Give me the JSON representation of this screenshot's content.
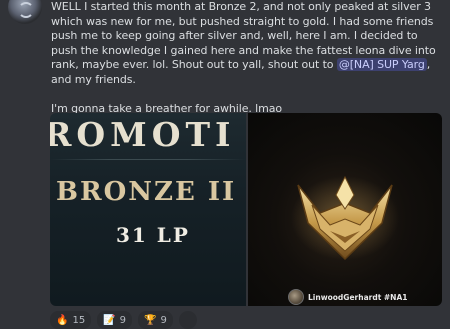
{
  "message": {
    "line1_part1": "WELL I started this month at Bronze 2, and not only peaked at silver 3 which was new for me, but pushed straight to gold. I had some friends push me to keep going after silver and, well, here I am. I decided to push the knowledge I gained here and make the fattest leona dive into rank, maybe ever. lol. Shout out to yall, shout out to ",
    "mention": "@[NA] SUP Yarg",
    "line1_part2": ", and my friends.",
    "line2": "I'm gonna take a breather for awhile. lmao"
  },
  "attachment_left": {
    "banner": "ROMOTI",
    "rank": "BRONZE II",
    "lp": "31 LP"
  },
  "attachment_right": {
    "watermark": "LinwoodGerhardt #NA1"
  },
  "reactions": [
    {
      "emoji": "🔥",
      "count": "15"
    },
    {
      "emoji": "📝",
      "count": "9"
    },
    {
      "emoji": "🏆",
      "count": "9"
    }
  ]
}
